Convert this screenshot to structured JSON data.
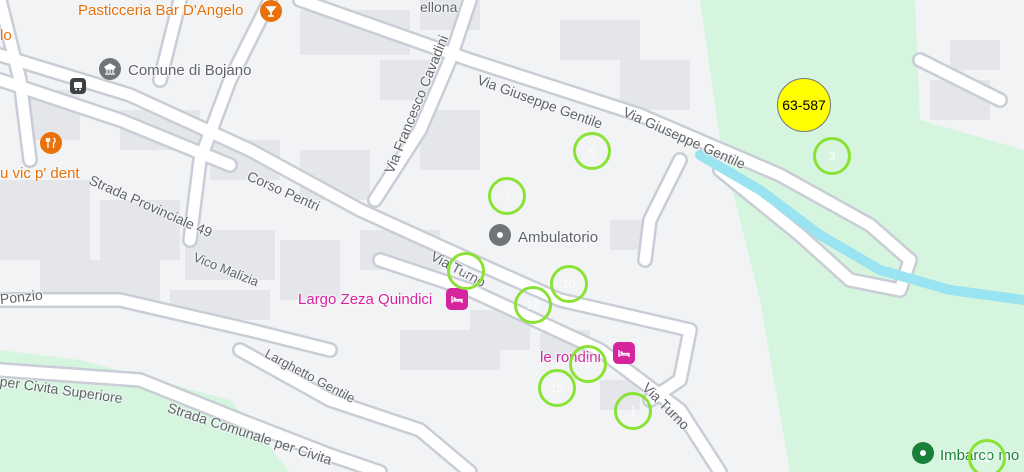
{
  "street_labels": [
    {
      "id": "via-giuseppe-gentile-1",
      "text": "Via Giuseppe Gentile"
    },
    {
      "id": "via-giuseppe-gentile-2",
      "text": "Via Giuseppe Gentile"
    },
    {
      "id": "via-francesco-cavadini",
      "text": "Via Francesco Cavadini"
    },
    {
      "id": "corso-pentri",
      "text": "Corso Pentri"
    },
    {
      "id": "strada-provinciale-49",
      "text": "Strada Provinciale 49"
    },
    {
      "id": "vico-malizia",
      "text": "Vico Malizia"
    },
    {
      "id": "via-turno-1",
      "text": "Via Turno"
    },
    {
      "id": "via-turno-2",
      "text": "Via Turno"
    },
    {
      "id": "ponzio",
      "text": "Ponzio"
    },
    {
      "id": "larghetto-gentile",
      "text": "Larghetto Gentile"
    },
    {
      "id": "per-civita-superiore",
      "text": "per Civita Superiore"
    },
    {
      "id": "strada-comunale",
      "text": "Strada Comunale per Civita"
    },
    {
      "id": "ellona",
      "text": "ellona"
    }
  ],
  "pois": [
    {
      "id": "pasticceria",
      "text": "Pasticceria Bar D'Angelo",
      "icon": "cafe-icon"
    },
    {
      "id": "lo",
      "text": "lo"
    },
    {
      "id": "comune",
      "text": "Comune di Bojano",
      "icon": "town-hall-icon"
    },
    {
      "id": "vic-p-dent",
      "text": "u vic p' dent",
      "icon": "restaurant-icon"
    },
    {
      "id": "ambulatorio",
      "text": "Ambulatorio",
      "icon": "place-icon"
    },
    {
      "id": "largo-zeza",
      "text": "Largo Zeza Quindici",
      "icon": "hotel-icon"
    },
    {
      "id": "le-rondini",
      "text": "le rondini",
      "icon": "hotel-icon"
    },
    {
      "id": "imbarco",
      "text": "Imbarco mo",
      "icon": "place-icon"
    }
  ],
  "markers": [
    {
      "id": "m1",
      "label": "6"
    },
    {
      "id": "m2",
      "label": "3"
    },
    {
      "id": "m3",
      "label": "7"
    },
    {
      "id": "m4",
      "label": "1"
    },
    {
      "id": "m5",
      "label": "10"
    },
    {
      "id": "m6",
      "label": "12"
    },
    {
      "id": "m7",
      "label": "6"
    },
    {
      "id": "m8",
      "label": "15"
    },
    {
      "id": "m9",
      "label": "1"
    },
    {
      "id": "m10",
      "label": "1"
    }
  ],
  "highlight": {
    "label": "63-587"
  },
  "colors": {
    "park": "#d5f5df",
    "water": "#9ae3f0",
    "road": "#ffffff",
    "road_outline": "#c8cdd6",
    "marker_ring": "#8ae234",
    "highlight": "#ffff00"
  }
}
